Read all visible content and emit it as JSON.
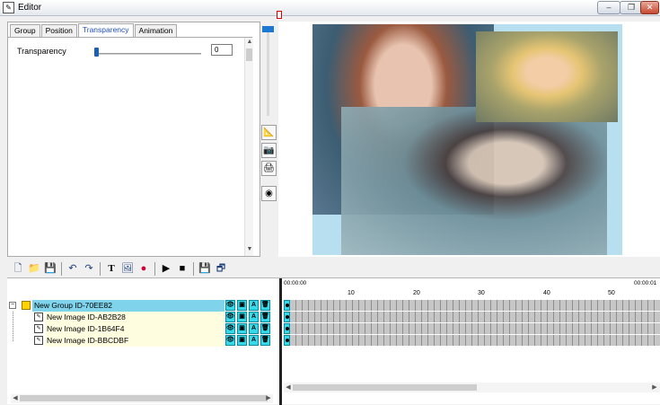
{
  "window": {
    "title": "Editor",
    "min": "–",
    "max": "❐",
    "close": "✕"
  },
  "tabs": [
    {
      "label": "Group"
    },
    {
      "label": "Position"
    },
    {
      "label": "Transparency",
      "active": true
    },
    {
      "label": "Animation"
    }
  ],
  "transparency": {
    "label": "Transparency",
    "value": "0",
    "level_percent": 0
  },
  "toolbar": {
    "new_icon": "new-file-icon",
    "open_icon": "open-folder-icon",
    "save_icon": "save-icon",
    "undo_icon": "undo-icon",
    "redo_icon": "redo-icon",
    "text_icon": "text-icon",
    "image_icon": "image-icon",
    "effects_icon": "effects-icon",
    "play_icon": "play-icon",
    "stop_icon": "stop-icon",
    "export_icon": "export-icon",
    "export_all_icon": "export-all-icon"
  },
  "side_tools": [
    "ruler-icon",
    "camera-icon",
    "printer-icon",
    "color-wheel-icon"
  ],
  "colors": {
    "accent": "#35d9ea",
    "selection": "#7fd3ea",
    "rowbg": "#fffde0",
    "tab_active": "#1f4fbf"
  },
  "tree": {
    "group": {
      "label": "New Group ID-70EE82"
    },
    "items": [
      {
        "label": "New Image ID-AB2B28"
      },
      {
        "label": "New Image ID-1B64F4"
      },
      {
        "label": "New Image ID-BBCDBF"
      }
    ],
    "actions": [
      "eye-icon",
      "lock-icon",
      "A",
      "trash-icon"
    ]
  },
  "timeline": {
    "start_time": "00:00:00",
    "end_time": "00:00:01",
    "ticks": [
      "10",
      "20",
      "30",
      "40",
      "50"
    ]
  }
}
